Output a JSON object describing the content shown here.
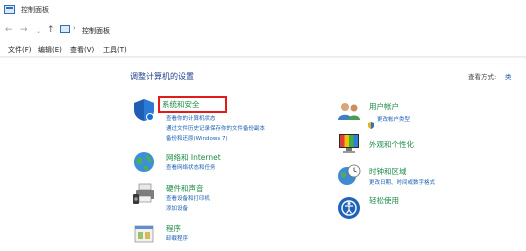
{
  "window": {
    "title": "控制面板"
  },
  "address": {
    "path": "控制面板",
    "separator": "›"
  },
  "nav": {
    "back": "←",
    "forward": "→",
    "dropdown": "⌄",
    "up": "↑"
  },
  "menu": {
    "file": "文件(F)",
    "edit": "编辑(E)",
    "view": "查看(V)",
    "tools": "工具(T)"
  },
  "main": {
    "title": "调整计算机的设置",
    "view_by_label": "查看方式:",
    "view_by_value": "类"
  },
  "categories_left": [
    {
      "title": "系统和安全",
      "links": [
        "查看你的计算机状态",
        "通过文件历史记录保存你的文件备份副本",
        "备份和还原(Windows 7)"
      ]
    },
    {
      "title": "网络和 Internet",
      "links": [
        "查看网络状态和任务"
      ]
    },
    {
      "title": "硬件和声音",
      "links": [
        "查看设备和打印机",
        "添加设备"
      ]
    },
    {
      "title": "程序",
      "links": [
        "卸载程序"
      ]
    }
  ],
  "categories_right": [
    {
      "title": "用户帐户",
      "links": [
        "更改帐户类型"
      ]
    },
    {
      "title": "外观和个性化",
      "links": []
    },
    {
      "title": "时钟和区域",
      "links": [
        "更改日期、时间或数字格式"
      ]
    },
    {
      "title": "轻松使用",
      "links": []
    }
  ]
}
